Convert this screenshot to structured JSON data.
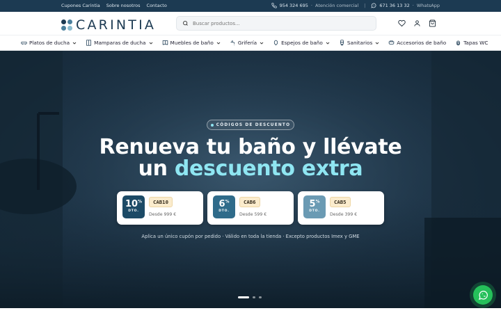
{
  "topbar": {
    "links": [
      "Cupones Carintia",
      "Sobre nosotros",
      "Contacto"
    ],
    "phone": "954 324 695",
    "phone_label": "Atención comercial",
    "whatsapp": "671 36 13 32",
    "whatsapp_label": "WhatsApp"
  },
  "header": {
    "logo_text": "CARINTIA",
    "search_placeholder": "Buscar productos..."
  },
  "nav": {
    "items": [
      {
        "label": "Platos de ducha",
        "icon": "shower-tray-icon",
        "dropdown": true
      },
      {
        "label": "Mamparas de ducha",
        "icon": "shower-screen-icon",
        "dropdown": true
      },
      {
        "label": "Muebles de baño",
        "icon": "cabinet-icon",
        "dropdown": true
      },
      {
        "label": "Grifería",
        "icon": "faucet-icon",
        "dropdown": true
      },
      {
        "label": "Espejos de baño",
        "icon": "mirror-icon",
        "dropdown": true
      },
      {
        "label": "Sanitarios",
        "icon": "toilet-icon",
        "dropdown": true
      },
      {
        "label": "Accesorios de baño",
        "icon": "accessories-icon",
        "dropdown": false
      },
      {
        "label": "Tapas WC",
        "icon": "toilet-seat-icon",
        "dropdown": false
      }
    ]
  },
  "hero": {
    "badge": "CÓDIGOS DE DESCUENTO",
    "title_line1": "Renueva tu baño y llévate",
    "title_line2_plain": "un ",
    "title_line2_accent": "descuento extra",
    "coupons": [
      {
        "percent": "10",
        "unit": "%",
        "dto": "DTO.",
        "code": "CAB10",
        "min": "Desde 999 €",
        "color": "#1c4a66"
      },
      {
        "percent": "6",
        "unit": "%",
        "dto": "DTO.",
        "code": "CAB6",
        "min": "Desde 599 €",
        "color": "#2f6b8a"
      },
      {
        "percent": "5",
        "unit": "%",
        "dto": "DTO.",
        "code": "CAB5",
        "min": "Desde 399 €",
        "color": "#6a9ab3"
      }
    ],
    "note": "Aplica un único cupón por pedido · Válido en toda la tienda · Excepto productos Imex y GME",
    "slides": 3,
    "active_slide": 0
  },
  "colors": {
    "topbar": "#1c3a52",
    "accent": "#8fe6f2",
    "whatsapp": "#25c05a",
    "logo_dots": [
      "#1c3a52",
      "#4a7f9c",
      "#4a7f9c",
      "#8cbdd0"
    ]
  }
}
